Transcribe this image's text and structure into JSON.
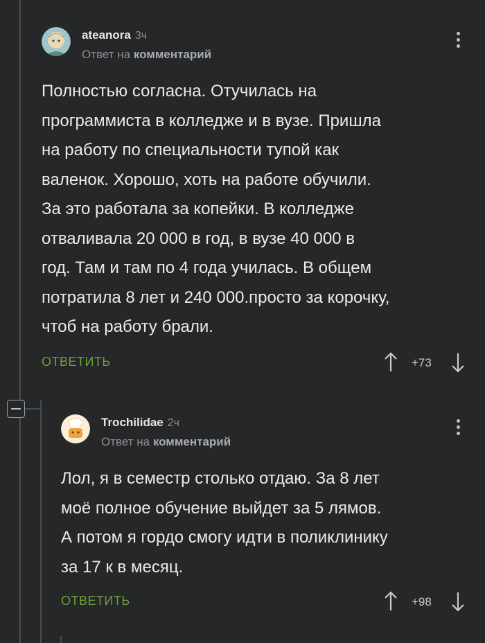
{
  "comments": [
    {
      "username": "ateanora",
      "time": "3ч",
      "reply_prefix": "Ответ на",
      "reply_target": "комментарий",
      "text": "Полностью согласна. Отучилась на\nпрограммиста в колледже и в вузе. Пришла\nна работу по специальности тупой как\nваленок. Хорошо, хоть на работе обучили.\nЗа это работала за копейки. В колледже\nотваливала 20 000 в год, в вузе 40 000 в\nгод. Там и там по 4 года училась. В общем\nпотратила 8 лет и 240 000.просто за корочку,\nчтоб на работу брали.",
      "reply_label": "ОТВЕТИТЬ",
      "rating": "+73"
    },
    {
      "username": "Trochilidae",
      "time": "2ч",
      "reply_prefix": "Ответ на",
      "reply_target": "комментарий",
      "text": "Лол, я в семестр столько отдаю. За 8 лет\nмоё полное обучение выйдет за 5 лямов.\nА потом я гордо смогу идти в поликлинику\nза 17 к в месяц.",
      "reply_label": "ОТВЕТИТЬ",
      "rating": "+98"
    }
  ],
  "icons": {
    "avatar1": "woman-avatar-icon",
    "avatar2": "chef-avatar-icon",
    "more": "more-vertical-icon",
    "up": "arrow-up-icon",
    "down": "arrow-down-icon",
    "collapse": "minus-box-icon"
  },
  "colors": {
    "background": "#252729",
    "accent_green": "#6ea03a",
    "text": "#ebebeb",
    "muted": "#8c8f92"
  }
}
